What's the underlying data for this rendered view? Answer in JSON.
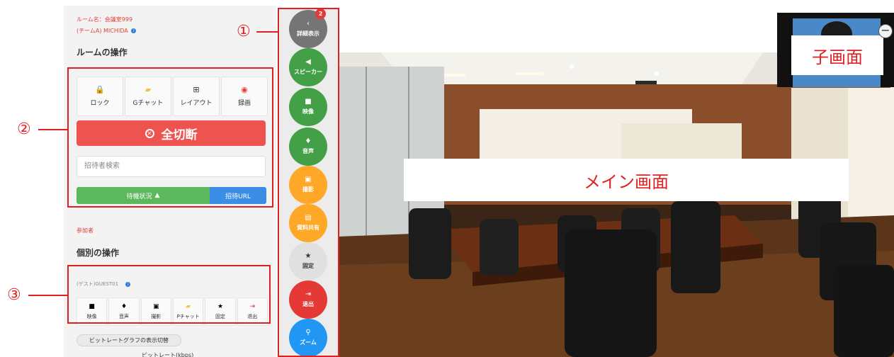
{
  "left_panel": {
    "room_name": "ルーム名：会議室999",
    "room_team": "(チームA) MICHIDA",
    "room_ops_title": "ルームの操作",
    "room_tools": [
      {
        "icon": "lock-icon",
        "glyph": "🔒",
        "color": "#e53935",
        "label": "ロック"
      },
      {
        "icon": "group-chat-icon",
        "glyph": "▰",
        "color": "#f5c043",
        "label": "Gチャット"
      },
      {
        "icon": "layout-icon",
        "glyph": "⊞",
        "color": "#333333",
        "label": "レイアウト"
      },
      {
        "icon": "record-icon",
        "glyph": "◉",
        "color": "#e53935",
        "label": "録画"
      }
    ],
    "hangup_all_label": "全切断",
    "invite_search_placeholder": "招待者検索",
    "waiting_label": "待機状況",
    "invite_url_label": "招待URL",
    "participants_label": "参加者",
    "individual_ops_title": "個別の操作",
    "guest_name": "(ゲスト)GUEST01",
    "guest_tools": [
      {
        "icon": "video-icon",
        "glyph": "■",
        "label": "映像"
      },
      {
        "icon": "mic-icon",
        "glyph": "♦",
        "label": "音声"
      },
      {
        "icon": "camera-icon",
        "glyph": "▣",
        "label": "撮影"
      },
      {
        "icon": "private-chat-icon",
        "glyph": "▰",
        "label": "Pチャット"
      },
      {
        "icon": "star-icon",
        "glyph": "★",
        "label": "固定"
      },
      {
        "icon": "exit-icon",
        "glyph": "⇥",
        "label": "退出"
      }
    ],
    "bitrate_toggle_label": "ビットレートグラフの表示切替",
    "bitrate_label": "ビットレート(kbps)"
  },
  "middle_column": {
    "buttons": [
      {
        "name": "details-toggle-button",
        "icon": "chevron-left-icon",
        "glyph": "‹",
        "label": "詳細表示",
        "color": "#757575",
        "badge": "2"
      },
      {
        "name": "speaker-button",
        "icon": "speaker-icon",
        "glyph": "◀",
        "label": "スピーカー",
        "color": "#43a047"
      },
      {
        "name": "video-button",
        "icon": "video-icon",
        "glyph": "■",
        "label": "映像",
        "color": "#43a047"
      },
      {
        "name": "audio-button",
        "icon": "mic-icon",
        "glyph": "♦",
        "label": "音声",
        "color": "#43a047"
      },
      {
        "name": "capture-button",
        "icon": "camera-icon",
        "glyph": "▣",
        "label": "撮影",
        "color": "#ffa726"
      },
      {
        "name": "share-docs-button",
        "icon": "share-icon",
        "glyph": "▤",
        "label": "資料共有",
        "color": "#ffa726"
      },
      {
        "name": "pin-button",
        "icon": "star-icon",
        "glyph": "★",
        "label": "固定",
        "color": "#e0e0e0"
      },
      {
        "name": "exit-button",
        "icon": "exit-icon",
        "glyph": "⇥",
        "label": "退出",
        "color": "#e53935"
      },
      {
        "name": "zoom-button",
        "icon": "zoom-icon",
        "glyph": "⚲",
        "label": "ズーム",
        "color": "#2196f3"
      }
    ]
  },
  "main_screen_label": "メイン画面",
  "sub_screen_label": "子画面",
  "callouts": [
    "①",
    "②",
    "③"
  ],
  "colors": {
    "annotation_red": "#e02020",
    "hangup_red": "#ef5350",
    "waiting_green": "#5cb85c",
    "url_blue": "#3a8ee6"
  }
}
